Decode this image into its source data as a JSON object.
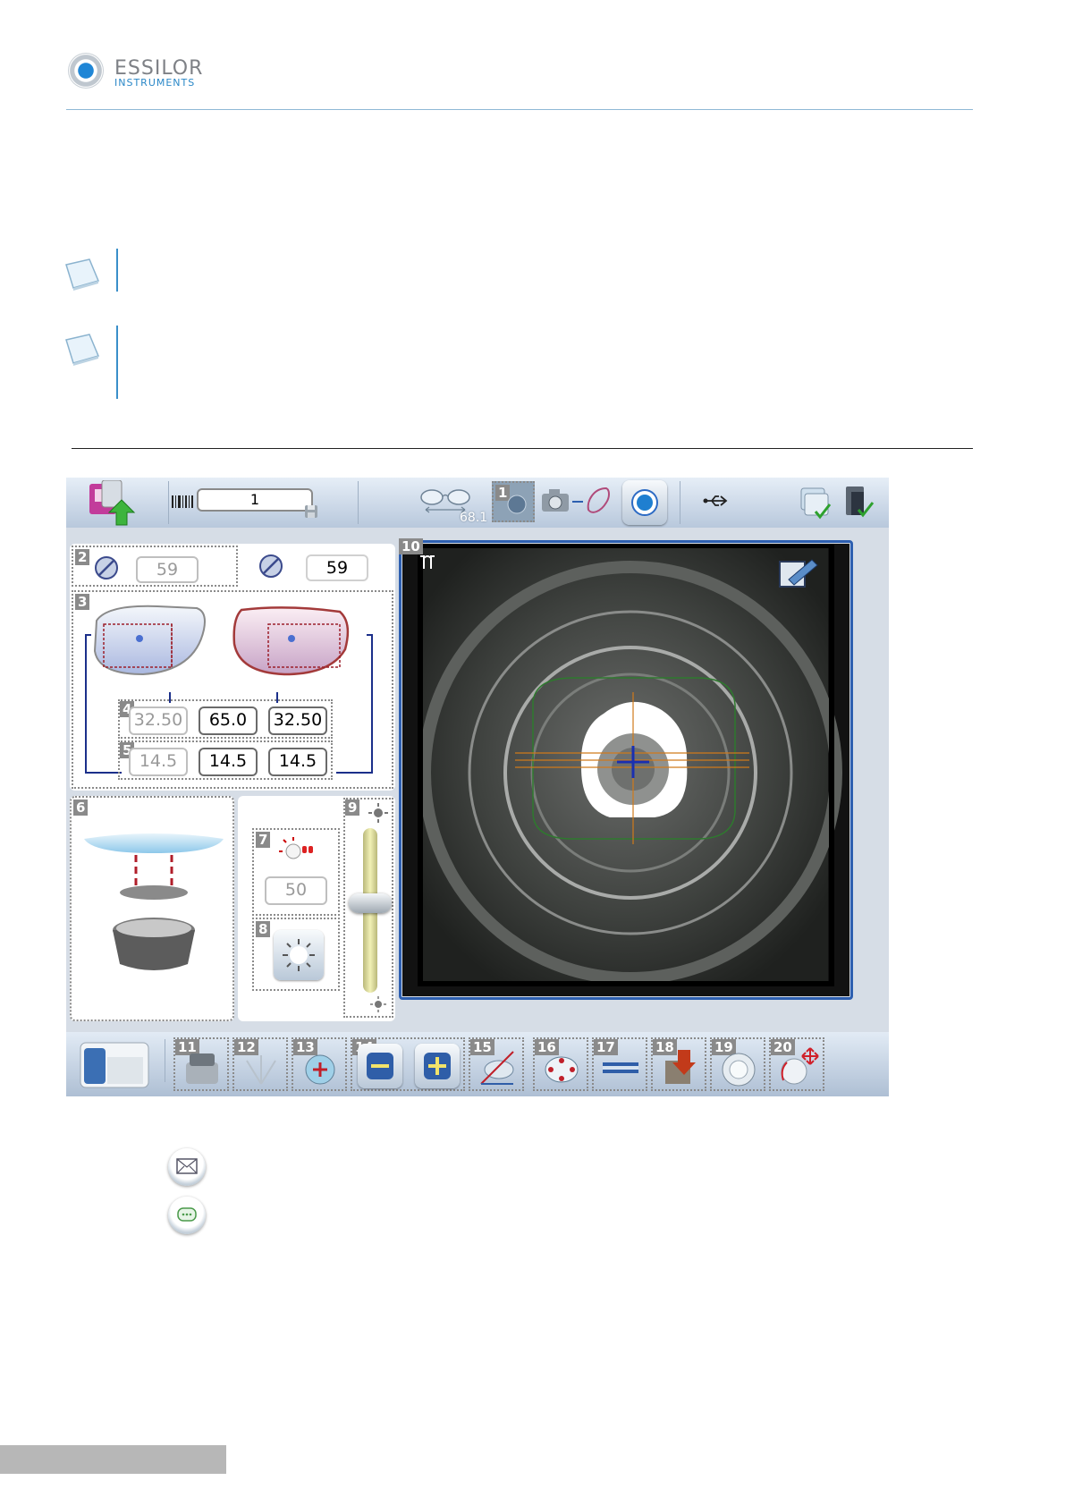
{
  "header": {
    "brand_line1": "ESSILOR",
    "brand_line2": "INSTRUMENTS"
  },
  "screen": {
    "job_number": "1",
    "frame_width": "68.1",
    "diameters": {
      "left": "59",
      "right": "59"
    },
    "pd": {
      "left": "32.50",
      "total": "65.0",
      "right": "32.50"
    },
    "heights": {
      "left": "14.5",
      "center": "14.5",
      "right": "14.5"
    },
    "light_intensity": "50",
    "brightness_level": 0.55,
    "callouts": [
      "1",
      "2",
      "3",
      "4",
      "5",
      "6",
      "7",
      "8",
      "9",
      "10",
      "11",
      "12",
      "13",
      "14",
      "15",
      "16",
      "17",
      "18",
      "19",
      "20"
    ]
  },
  "colors": {
    "accent": "#2b88c8",
    "frame_border": "#2d5fb0"
  },
  "icons": {
    "top": [
      "load-job-icon",
      "barcode-icon",
      "save-icon",
      "frame-glasses-icon",
      "centering-view-icon",
      "camera-icon",
      "lens-shape-icon",
      "target-icon",
      "usb-icon",
      "lens-stack-icon",
      "exit-icon"
    ],
    "bottom": [
      "edger-icon",
      "tool-icon",
      "lens-center-icon",
      "minus-icon",
      "plus-icon",
      "shape-edit-icon",
      "drill-icon",
      "bevel-icon",
      "block-icon",
      "pd-mode-icon",
      "rotate-move-icon"
    ],
    "legend": [
      "mail-button-icon",
      "message-button-icon"
    ]
  }
}
